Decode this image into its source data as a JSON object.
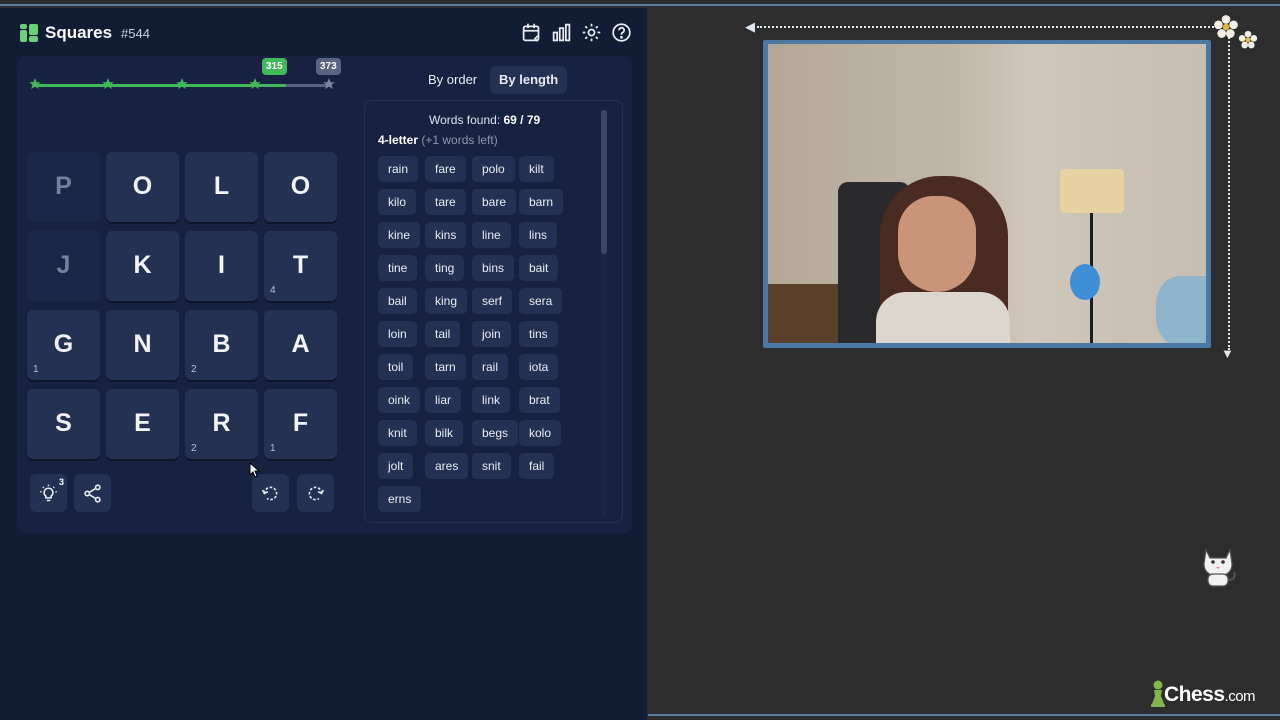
{
  "header": {
    "title": "Squares",
    "puzzle_number": "#544",
    "icons": [
      "calendar-icon",
      "stats-icon",
      "settings-icon",
      "help-icon"
    ]
  },
  "progress": {
    "current_score": "315",
    "max_score": "373",
    "fill_fraction": 0.85,
    "colors": {
      "achieved": "#41b95b",
      "pending": "#59647e"
    }
  },
  "grid": [
    [
      {
        "letter": "P",
        "count": "",
        "used": true
      },
      {
        "letter": "O",
        "count": "",
        "used": false
      },
      {
        "letter": "L",
        "count": "",
        "used": false
      },
      {
        "letter": "O",
        "count": "",
        "used": false
      }
    ],
    [
      {
        "letter": "J",
        "count": "",
        "used": true
      },
      {
        "letter": "K",
        "count": "",
        "used": false
      },
      {
        "letter": "I",
        "count": "",
        "used": false
      },
      {
        "letter": "T",
        "count": "4",
        "used": false
      }
    ],
    [
      {
        "letter": "G",
        "count": "1",
        "used": false
      },
      {
        "letter": "N",
        "count": "",
        "used": false
      },
      {
        "letter": "B",
        "count": "2",
        "used": false
      },
      {
        "letter": "A",
        "count": "",
        "used": false
      }
    ],
    [
      {
        "letter": "S",
        "count": "",
        "used": false
      },
      {
        "letter": "E",
        "count": "",
        "used": false
      },
      {
        "letter": "R",
        "count": "2",
        "used": false
      },
      {
        "letter": "F",
        "count": "1",
        "used": false
      }
    ]
  ],
  "controls": {
    "hint_count": "3"
  },
  "sort": {
    "by_order": "By order",
    "by_length": "By length"
  },
  "words_panel": {
    "found_label": "Words found:",
    "found_value": "69 / 79",
    "section_label": "4-letter",
    "section_remaining": "(+1 words left)",
    "words": [
      "rain",
      "fare",
      "polo",
      "kilt",
      "kilo",
      "tare",
      "bare",
      "barn",
      "kine",
      "kins",
      "line",
      "lins",
      "tine",
      "ting",
      "bins",
      "bait",
      "bail",
      "king",
      "serf",
      "sera",
      "loin",
      "tail",
      "join",
      "tins",
      "toil",
      "tarn",
      "rail",
      "iota",
      "oink",
      "liar",
      "link",
      "brat",
      "knit",
      "bilk",
      "begs",
      "kolo",
      "jolt",
      "ares",
      "snit",
      "fail",
      "erns"
    ]
  },
  "brand": {
    "name": "Chess",
    "suffix": ".com"
  }
}
